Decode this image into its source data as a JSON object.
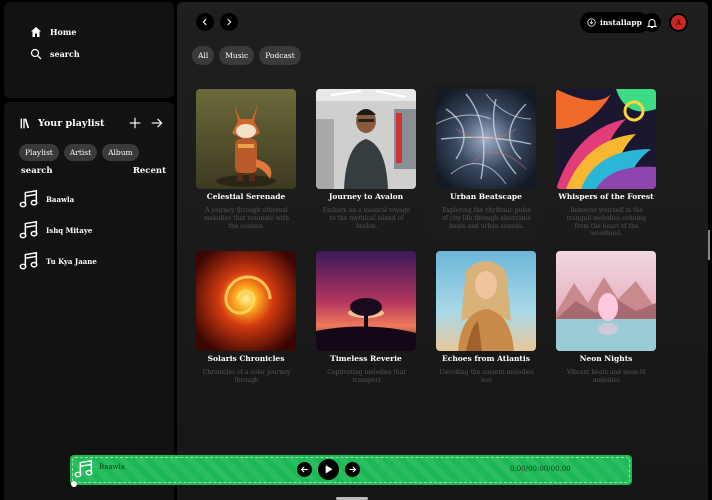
{
  "nav": {
    "home_label": "Home",
    "search_label": "search"
  },
  "library": {
    "title": "Your playlist",
    "chips": [
      "Playlist",
      "Artist",
      "Album"
    ],
    "search_label": "search",
    "sort_label": "Recent",
    "playlists": [
      {
        "name": "Baawla"
      },
      {
        "name": "Ishq Mitaye"
      },
      {
        "name": "Tu Kya Jaane"
      }
    ]
  },
  "header": {
    "install_label": "installapp",
    "avatar_initial": "A"
  },
  "filters": [
    "All",
    "Music",
    "Podcast"
  ],
  "cards": [
    {
      "title": "Celestial Serenade",
      "desc": "A journey through ethereal melodies that resonate with the cosmos.",
      "art": "fox"
    },
    {
      "title": "Journey to Avalon",
      "desc": "Embark on a musical voyage to the mythical island of Avalon.",
      "art": "man"
    },
    {
      "title": "Urban Beatscape",
      "desc": "Exploring the rhythmic pulse of city life through electronic beats and urban sounds.",
      "art": "galaxy"
    },
    {
      "title": "Whispers of the Forest",
      "desc": "Immerse yourself in the tranquil melodies echoing from the heart of the woodland.",
      "art": "swirl"
    },
    {
      "title": "Solaris Chronicles",
      "desc": "Chronicles of a solar journey through",
      "art": "spiral"
    },
    {
      "title": "Timeless Reverie",
      "desc": "Captivating melodies that transport",
      "art": "tree"
    },
    {
      "title": "Echoes from Atlantis",
      "desc": "Unveiling the ancient melodies lost",
      "art": "woman"
    },
    {
      "title": "Neon Nights",
      "desc": "Vibrant beats and neon-lit melodies",
      "art": "mountain"
    }
  ],
  "player": {
    "song": "Baawla",
    "time": "0:00/00:00/00.00"
  },
  "colors": {
    "accent": "#1db954",
    "avatar": "#cc2525",
    "panel": "#121212"
  }
}
